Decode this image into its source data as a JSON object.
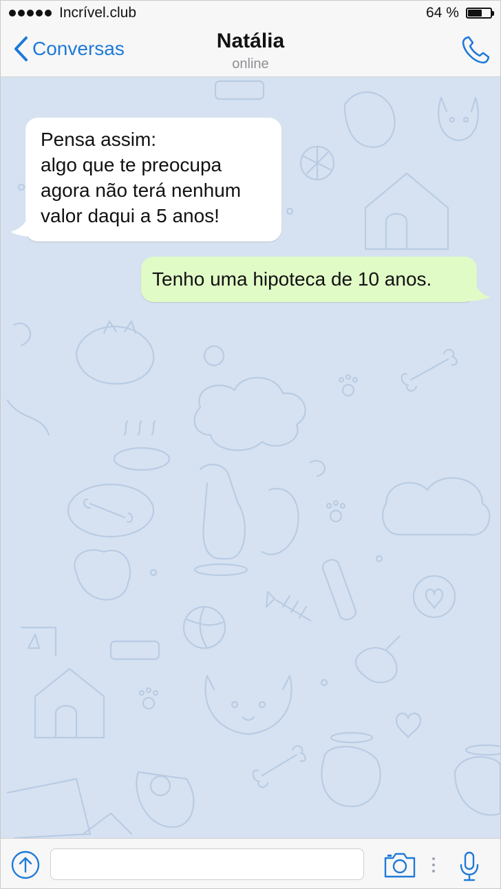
{
  "status_bar": {
    "carrier": "Incrível.club",
    "battery": "64 %",
    "battery_level": 0.64,
    "signal_bars": 5
  },
  "nav": {
    "back_label": "Conversas",
    "contact_name": "Natália",
    "contact_status": "online"
  },
  "messages": [
    {
      "direction": "incoming",
      "lines": [
        "Pensa assim:",
        "algo que te preocupa",
        "agora não terá nenhum",
        "valor daqui a 5 anos!"
      ]
    },
    {
      "direction": "outgoing",
      "text": "Tenho uma hipoteca de 10 anos."
    }
  ],
  "input": {
    "value": "",
    "placeholder": ""
  },
  "icons": {
    "back": "chevron-left-icon",
    "call": "phone-icon",
    "attach": "attach-icon",
    "camera": "camera-icon",
    "more": "more-dots-icon",
    "mic": "microphone-icon"
  },
  "colors": {
    "accent": "#1e7ad6",
    "chat_background": "#d6e2f1",
    "incoming_bubble": "#ffffff",
    "outgoing_bubble": "#e1fbc7",
    "doodle_stroke": "#b4c8e2"
  }
}
